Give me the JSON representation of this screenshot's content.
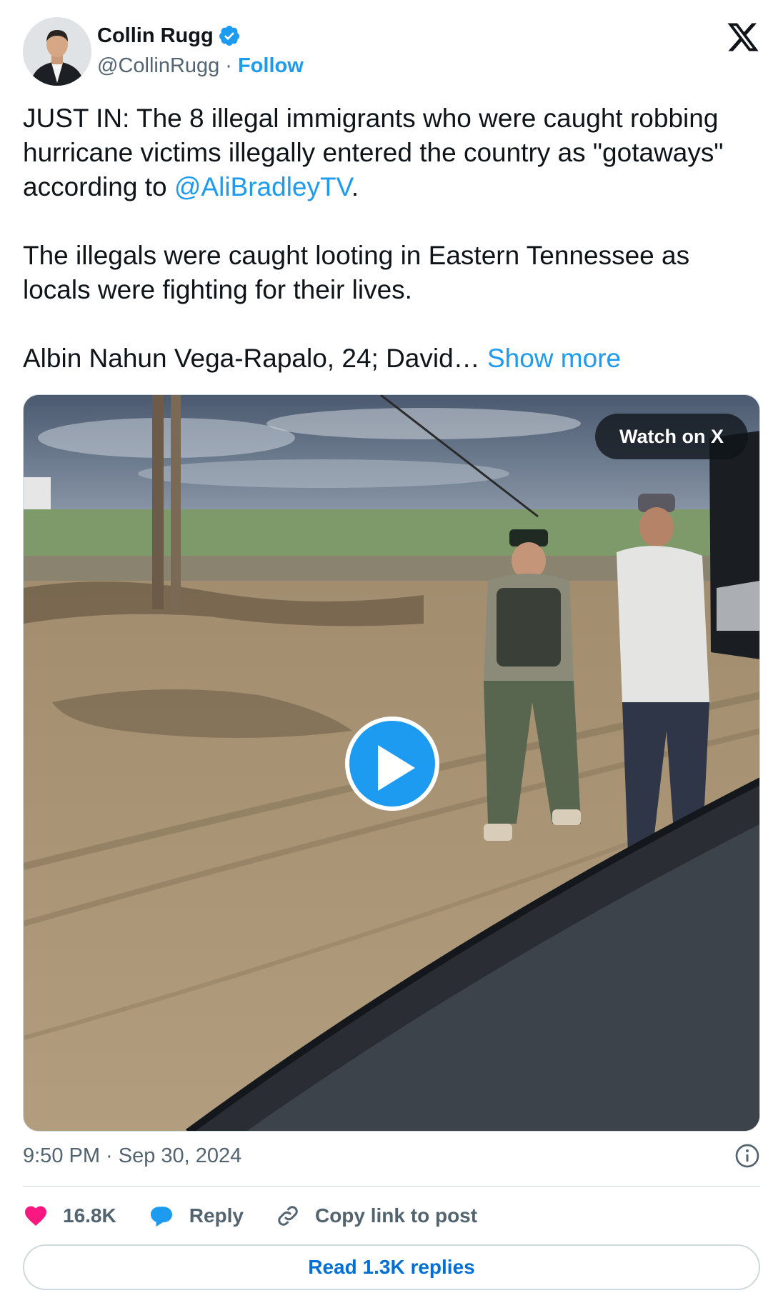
{
  "author": {
    "display_name": "Collin Rugg",
    "handle": "@CollinRugg",
    "separator": "·",
    "follow_label": "Follow",
    "verified": true,
    "verified_color": "#1d9bf0"
  },
  "tweet": {
    "para1_before": "JUST IN: The 8 illegal immigrants who were caught robbing hurricane victims illegally entered the country as \"gotaways\" according to ",
    "para1_mention": "@AliBradleyTV",
    "para1_after": ".",
    "para2": "The illegals were caught looting in Eastern Tennessee as locals were fighting for their lives.",
    "para3": "Albin Nahun Vega-Rapalo, 24; David…",
    "show_more": "Show more"
  },
  "media": {
    "type": "video",
    "watch_label": "Watch on X"
  },
  "timestamp": "9:50 PM · Sep 30, 2024",
  "actions": {
    "likes": "16.8K",
    "reply": "Reply",
    "copy_link": "Copy link to post"
  },
  "read_replies": "Read 1.3K replies",
  "colors": {
    "accent": "#1d9bf0",
    "like": "#f91880",
    "text_primary": "#0f1419",
    "text_secondary": "#536471",
    "border": "#cfd9de"
  },
  "icons": [
    "verified-badge-icon",
    "x-logo-icon",
    "play-icon",
    "info-icon",
    "heart-icon",
    "reply-icon",
    "link-icon"
  ]
}
